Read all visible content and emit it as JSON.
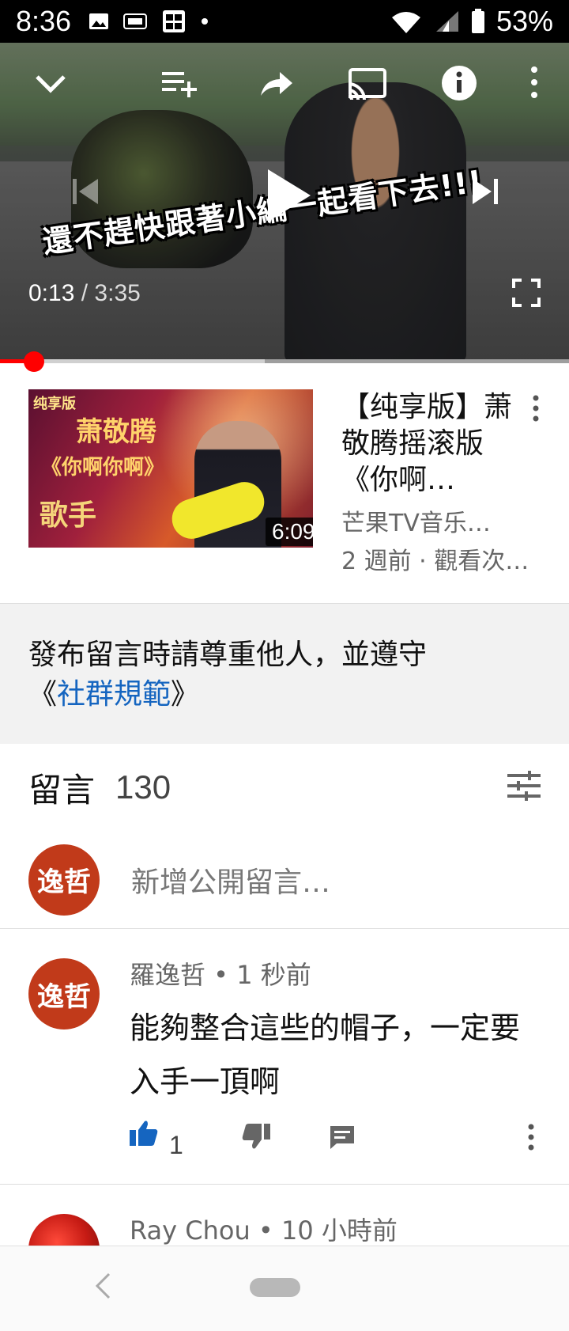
{
  "status_bar": {
    "time": "8:36",
    "battery_pct": "53%"
  },
  "player": {
    "caption": "還不趕快跟著小編一起看下去!!!",
    "time_current": "0:13",
    "time_separator": "/",
    "time_total": "3:35",
    "progress_fraction": 0.06,
    "buffer_fraction": 0.465
  },
  "next_video": {
    "thumbnail_tag": "纯享版",
    "thumbnail_name": "萧敬腾",
    "thumbnail_song": "《你啊你啊》",
    "thumbnail_logo": "歌手",
    "duration": "6:09",
    "title": "【纯享版】萧敬腾摇滚版《你啊…",
    "channel": "芒果TV音乐…",
    "meta": "2 週前 · 觀看次…"
  },
  "guideline": {
    "text": "發布留言時請尊重他人，並遵守",
    "link_prefix": "《",
    "link_text": "社群規範",
    "link_suffix": "》"
  },
  "comments": {
    "title": "留言",
    "count": "130",
    "add_placeholder": "新增公開留言…",
    "my_avatar_text": "逸哲",
    "items": [
      {
        "avatar_text": "逸哲",
        "header": "羅逸哲 • 1 秒前",
        "body": "能夠整合這些的帽子，一定要入手一頂啊",
        "likes": "1"
      },
      {
        "header": "Ray Chou • 10 小時前"
      }
    ]
  },
  "colors": {
    "accent_red": "#ff0000",
    "link_blue": "#1565c0",
    "like_blue": "#1565c0",
    "avatar_red": "#c13a1a"
  }
}
